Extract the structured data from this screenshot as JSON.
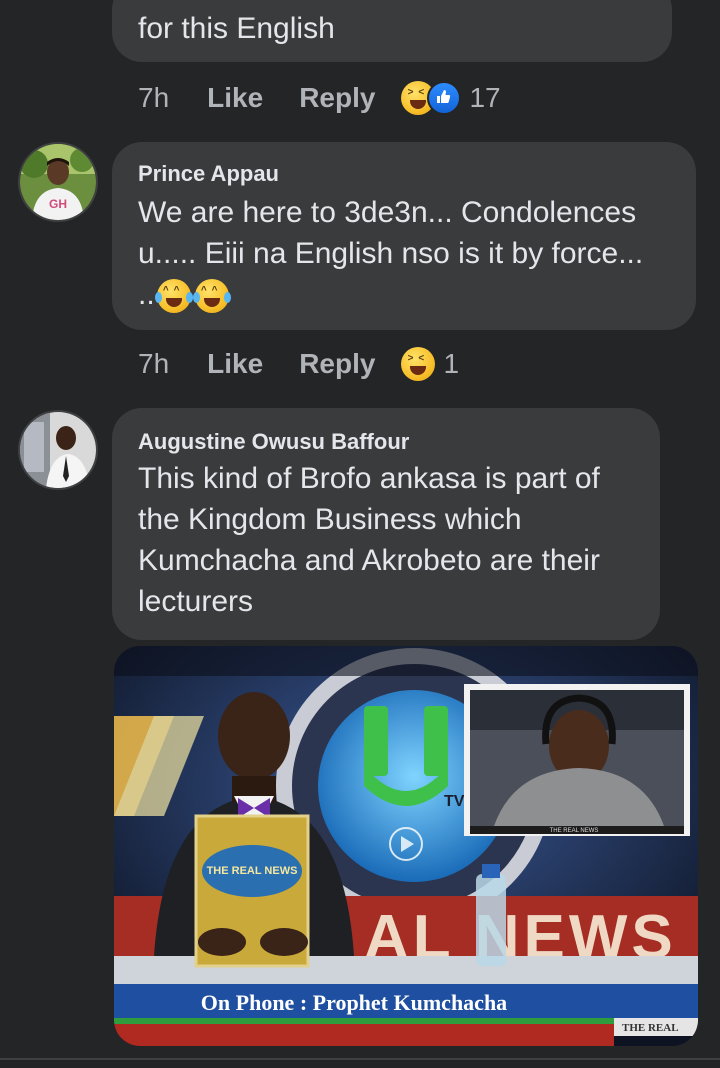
{
  "comments": [
    {
      "text": "for this English",
      "time": "7h",
      "like_label": "Like",
      "reply_label": "Reply",
      "reactions": [
        "laughing-face-icon",
        "like-thumb-icon"
      ],
      "reaction_count": "17"
    },
    {
      "author": "Prince Appau",
      "text": "We are here to 3de3n... Condolences\nu..... Eiii na English nso is it by force...\n..",
      "text_emojis": [
        "tears-of-joy-icon",
        "tears-of-joy-icon"
      ],
      "avatar_shirt_text": "GH",
      "time": "7h",
      "like_label": "Like",
      "reply_label": "Reply",
      "reactions": [
        "laughing-face-icon"
      ],
      "reaction_count": "1"
    },
    {
      "author": "Augustine Owusu Baffour",
      "text": "This kind of Brofo ankasa is part of\nthe Kingdom Business which\nKumchacha and Akrobeto are their\nlecturers",
      "attachment": {
        "lower_third": "On Phone : Prophet Kumchacha",
        "ticker_tag": "THE REAL",
        "backdrop_text": "AL NEWS",
        "tv_label": "TV",
        "book_title": "THE REAL NEWS",
        "inset_caption": "THE REAL NEWS"
      }
    }
  ],
  "colors": {
    "background": "#242526",
    "bubble": "#3a3b3c",
    "text": "#e4e6eb",
    "meta": "#b0b3b8",
    "like_blue": "#1877f2"
  }
}
